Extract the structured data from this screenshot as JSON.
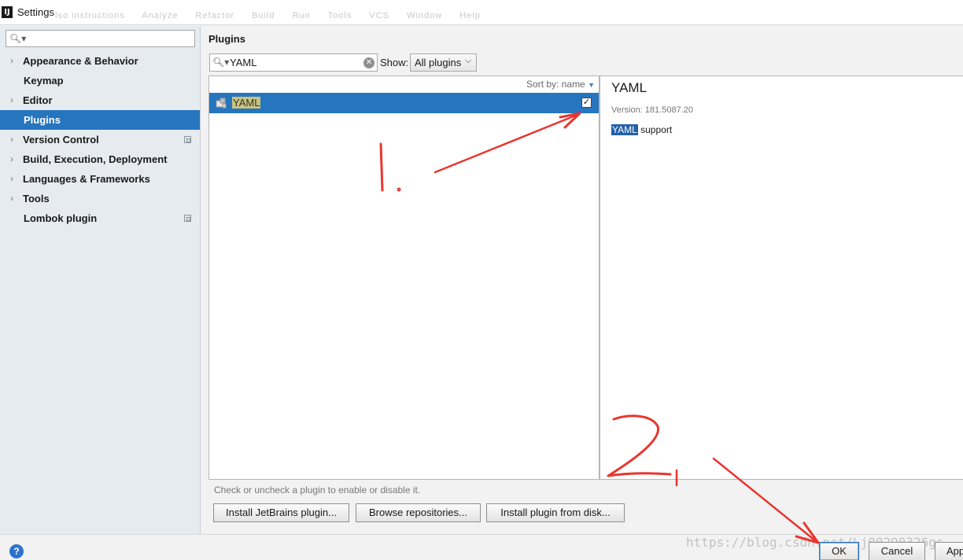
{
  "window": {
    "title": "Settings",
    "app_icon_text": "IJ",
    "background_text": [
      "lso instructions",
      "Analyze",
      "Refactor",
      "Build",
      "Run",
      "Tools",
      "VCS",
      "Window",
      "Help"
    ]
  },
  "sidebar": {
    "search_placeholder": "",
    "items": [
      {
        "label": "Appearance & Behavior",
        "has_arrow": true,
        "selected": false,
        "project_icon": false
      },
      {
        "label": "Keymap",
        "has_arrow": false,
        "selected": false,
        "project_icon": false
      },
      {
        "label": "Editor",
        "has_arrow": true,
        "selected": false,
        "project_icon": false
      },
      {
        "label": "Plugins",
        "has_arrow": false,
        "selected": true,
        "project_icon": false
      },
      {
        "label": "Version Control",
        "has_arrow": true,
        "selected": false,
        "project_icon": true
      },
      {
        "label": "Build, Execution, Deployment",
        "has_arrow": true,
        "selected": false,
        "project_icon": false
      },
      {
        "label": "Languages & Frameworks",
        "has_arrow": true,
        "selected": false,
        "project_icon": false
      },
      {
        "label": "Tools",
        "has_arrow": true,
        "selected": false,
        "project_icon": false
      },
      {
        "label": "Lombok plugin",
        "has_arrow": false,
        "selected": false,
        "project_icon": true
      }
    ]
  },
  "plugins": {
    "title": "Plugins",
    "search_value": "YAML",
    "show_label": "Show:",
    "show_selected": "All plugins",
    "sort_label": "Sort by: name",
    "list": [
      {
        "name": "YAML",
        "enabled": true,
        "selected": true
      }
    ],
    "detail": {
      "name": "YAML",
      "version": "Version: 181.5087.20",
      "desc_highlight": "YAML",
      "desc_rest": " support"
    },
    "hint": "Check or uncheck a plugin to enable or disable it.",
    "buttons": {
      "install_jetbrains": "Install JetBrains plugin...",
      "browse": "Browse repositories...",
      "install_disk": "Install plugin from disk..."
    }
  },
  "footer": {
    "help": "?",
    "ok": "OK",
    "cancel": "Cancel",
    "apply": "Apply",
    "watermark": "https://blog.csdn.net/Lj00290326gs"
  },
  "annotations": {
    "step1": "1.",
    "step2": "2.",
    "color": "#e8362f"
  },
  "colors": {
    "selection": "#2675bf",
    "sidebar_bg": "#e6ebf0",
    "name_highlight": "#c9c37d"
  }
}
